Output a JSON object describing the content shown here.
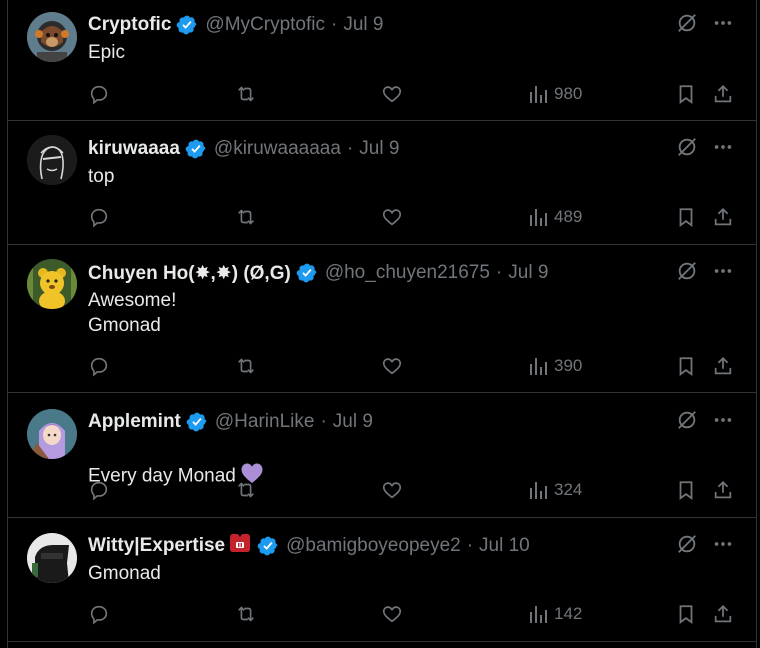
{
  "colors": {
    "background": "#000000",
    "text": "#e7e9ea",
    "muted": "#71767b",
    "border": "#2f3336",
    "verified": "#1d9bf0"
  },
  "tweets": [
    {
      "name": "Cryptofic",
      "handle": "@MyCryptofic",
      "separator": "·",
      "time": "Jul 9",
      "text": "Epic",
      "views": "980",
      "avatar_icon": "dog-astronaut-avatar"
    },
    {
      "name": "kiruwaaaa",
      "handle": "@kiruwaaaaaa",
      "separator": "·",
      "time": "Jul 9",
      "text": "top",
      "views": "489",
      "avatar_icon": "line-art-face-avatar"
    },
    {
      "name": "Chuyen Ho(✸,✸) (Ø,G)",
      "handle": "@ho_chuyen21675",
      "separator": "·",
      "time": "Jul 9",
      "text": "Awesome!\nGmonad",
      "views": "390",
      "avatar_icon": "yellow-bear-avatar"
    },
    {
      "name": "Applemint",
      "handle": "@HarinLike",
      "separator": "·",
      "time": "Jul 9",
      "text": "Every day Monad",
      "text_emoji": "purple-heart-icon",
      "views": "324",
      "avatar_icon": "anime-girl-avatar"
    },
    {
      "name": "Witty|Expertise",
      "name_emoji": "red-badge-icon",
      "handle": "@bamigboyeopeye2",
      "separator": "·",
      "time": "Jul 10",
      "text": "Gmonad",
      "views": "142",
      "avatar_icon": "dark-character-avatar"
    }
  ],
  "icons": {
    "reply": "reply-icon",
    "retweet": "retweet-icon",
    "like": "like-icon",
    "views": "views-icon",
    "bookmark": "bookmark-icon",
    "share": "share-icon",
    "grok": "grok-icon",
    "more": "more-icon",
    "verified": "verified-badge-icon"
  }
}
